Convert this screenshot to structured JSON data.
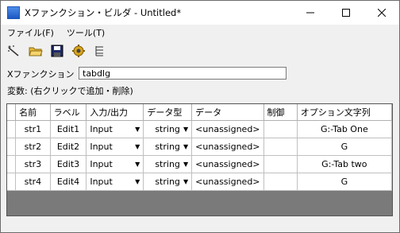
{
  "window": {
    "title": "Xファンクション・ビルダ - Untitled*"
  },
  "menu": {
    "file": "ファイル(F)",
    "tools": "ツール(T)"
  },
  "toolbar": {
    "icons": [
      "new-wand-icon",
      "open-folder-icon",
      "save-icon",
      "gear-icon",
      "tree-icon"
    ]
  },
  "xfunc": {
    "label": "Xファンクション",
    "value": "tabdlg"
  },
  "vars_label": "変数: (右クリックで追加・削除)",
  "table": {
    "headers": [
      "名前",
      "ラベル",
      "入力/出力",
      "データ型",
      "データ",
      "制御",
      "オプション文字列"
    ],
    "rows": [
      {
        "name": "str1",
        "label": "Edit1",
        "io": "Input",
        "type": "string",
        "data": "<unassigned>",
        "control": "",
        "option": "G:-Tab One"
      },
      {
        "name": "str2",
        "label": "Edit2",
        "io": "Input",
        "type": "string",
        "data": "<unassigned>",
        "control": "",
        "option": "G"
      },
      {
        "name": "str3",
        "label": "Edit3",
        "io": "Input",
        "type": "string",
        "data": "<unassigned>",
        "control": "",
        "option": "G:-Tab two"
      },
      {
        "name": "str4",
        "label": "Edit4",
        "io": "Input",
        "type": "string",
        "data": "<unassigned>",
        "control": "",
        "option": "G"
      }
    ]
  }
}
